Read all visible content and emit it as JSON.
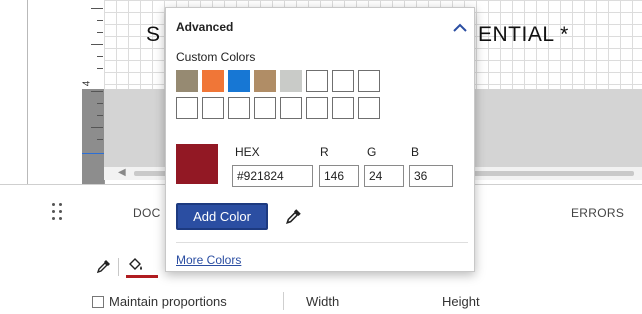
{
  "background": {
    "banner_left": "S",
    "banner_right": "ENTIAL *",
    "ruler_number": "4"
  },
  "toolbar": {
    "tab_doc": "DOC",
    "tab_errors": "ERRORS",
    "maintain_proportions": "Maintain proportions",
    "width_label": "Width",
    "height_label": "Height",
    "fill_color": "#b01c20"
  },
  "popup": {
    "title": "Advanced",
    "custom_colors_label": "Custom Colors",
    "swatches": [
      "#968a72",
      "#f07637",
      "#1777d4",
      "#b08d66",
      "#c9cbc8",
      "",
      "",
      "",
      "",
      "",
      "",
      "",
      "",
      "",
      "",
      ""
    ],
    "current_color": "#921824",
    "hex_label": "HEX",
    "hex_value": "#921824",
    "r_label": "R",
    "r_value": "146",
    "g_label": "G",
    "g_value": "24",
    "b_label": "B",
    "b_value": "36",
    "add_color_label": "Add Color",
    "more_colors_label": "More Colors",
    "icons": [
      "chevron-up-icon",
      "eyedropper-icon"
    ]
  }
}
